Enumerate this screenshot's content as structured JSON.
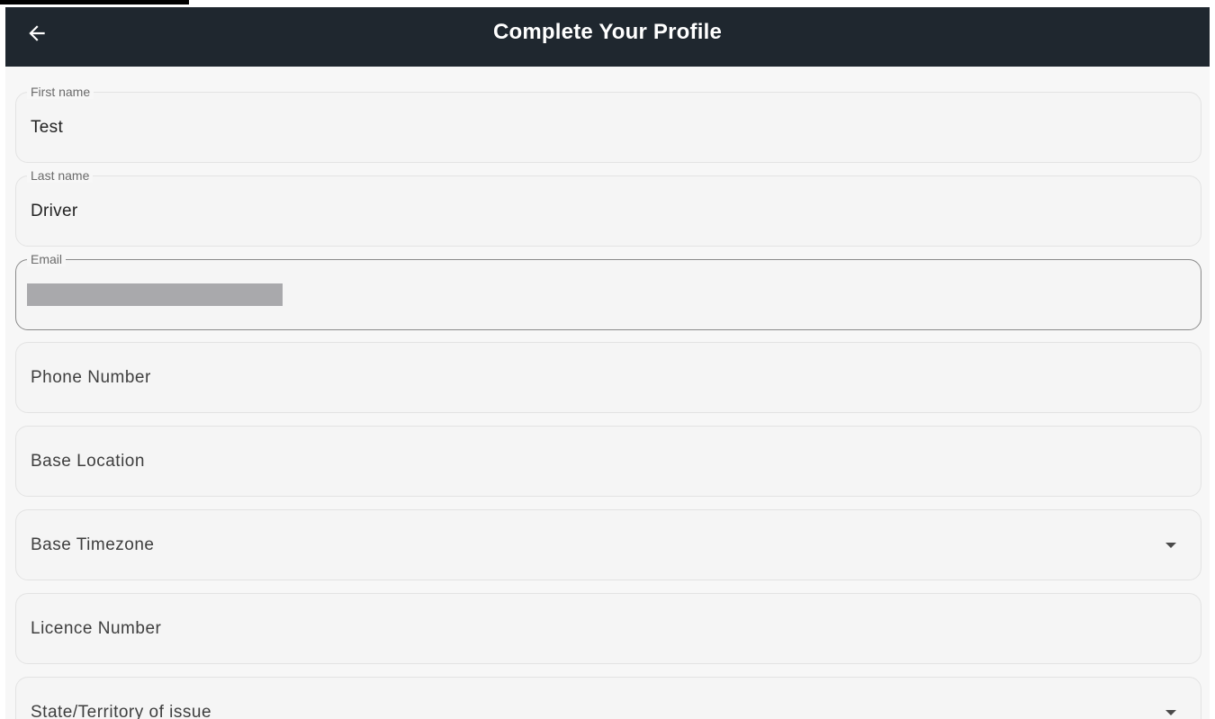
{
  "appbar": {
    "title": "Complete Your Profile",
    "back_icon": "arrow-left-icon"
  },
  "form": {
    "first_name": {
      "label": "First name",
      "value": "Test"
    },
    "last_name": {
      "label": "Last name",
      "value": "Driver"
    },
    "email": {
      "label": "Email",
      "value_redacted": true
    },
    "phone_number": {
      "placeholder": "Phone Number"
    },
    "base_location": {
      "placeholder": "Base Location"
    },
    "base_timezone": {
      "placeholder": "Base Timezone",
      "icon": "dropdown-caret-icon"
    },
    "licence_number": {
      "placeholder": "Licence Number"
    },
    "state_territory": {
      "placeholder": "State/Territory of issue",
      "icon": "dropdown-caret-icon"
    }
  },
  "colors": {
    "appbar_bg": "#1f272f",
    "content_bg": "#f7f7f7",
    "field_border": "#e3e3e3",
    "focused_border": "#8a8a8a"
  }
}
